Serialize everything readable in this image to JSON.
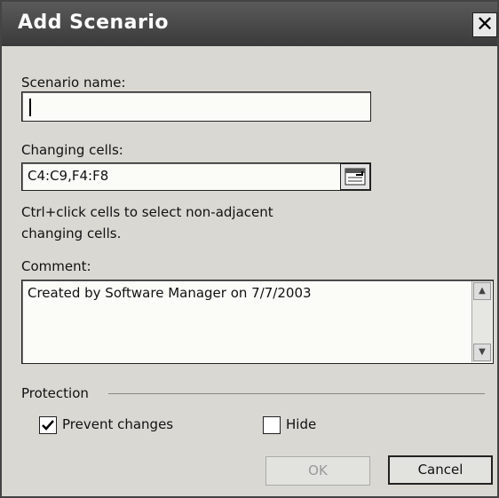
{
  "dialog": {
    "title": "Add Scenario"
  },
  "scenario_name": {
    "label": "Scenario name:",
    "value": ""
  },
  "changing_cells": {
    "label": "Changing cells:",
    "value": "C4:C9,F4:F8",
    "hint_line1": "Ctrl+click cells to select non-adjacent",
    "hint_line2": "changing cells."
  },
  "comment": {
    "label": "Comment:",
    "value": "Created by Software Manager on 7/7/2003"
  },
  "protection": {
    "label": "Protection",
    "prevent_changes": {
      "label": "Prevent changes",
      "checked": true
    },
    "hide": {
      "label": "Hide",
      "checked": false
    }
  },
  "buttons": {
    "ok": "OK",
    "cancel": "Cancel"
  },
  "icons": {
    "close": "close-icon",
    "collapse": "collapse-dialog-icon",
    "check": "checkmark-icon"
  }
}
